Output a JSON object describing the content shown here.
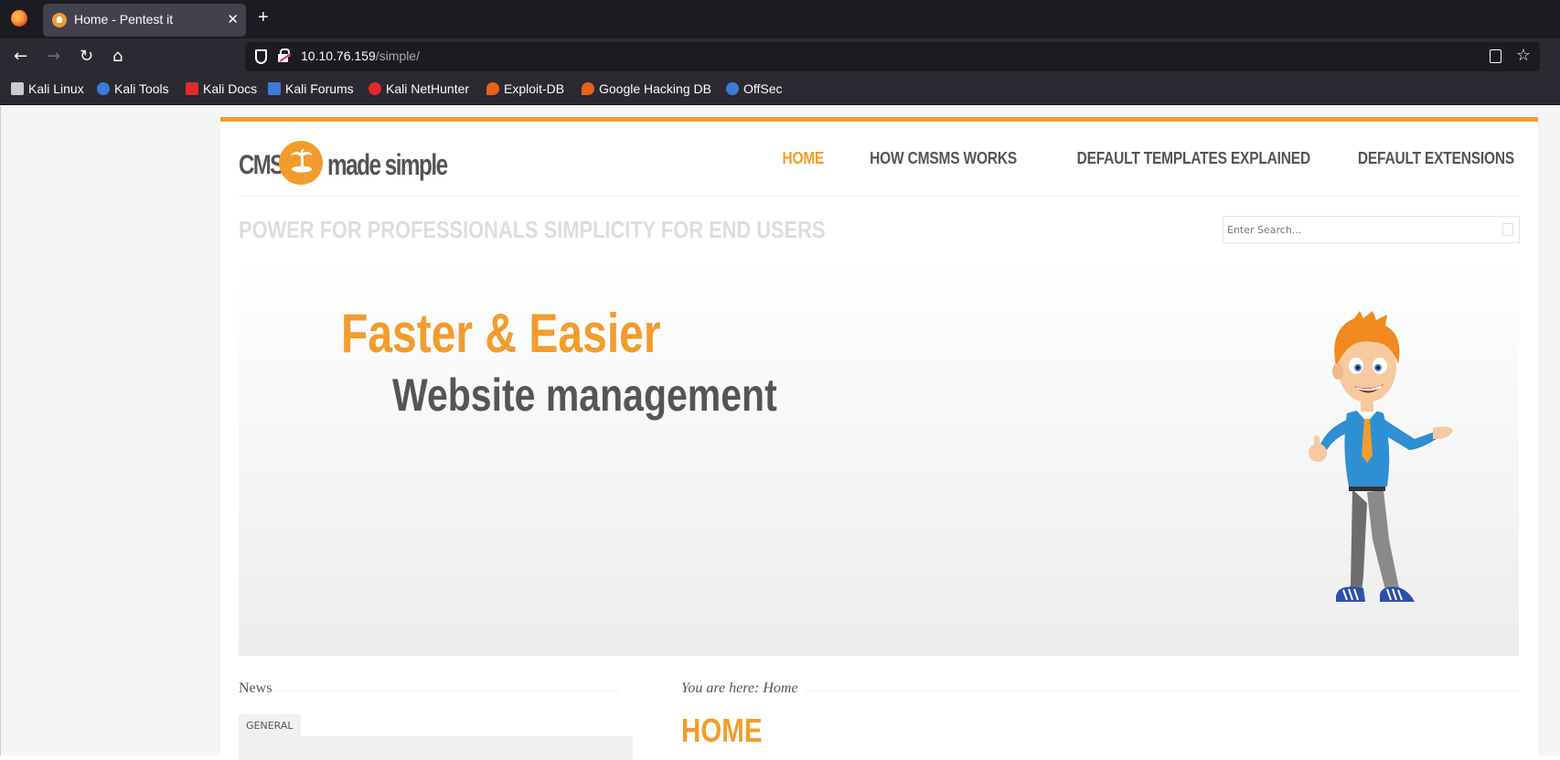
{
  "browser": {
    "tab_title": "Home - Pentest it",
    "tab_close": "✕",
    "new_tab": "+",
    "url_host": "10.10.76.159",
    "url_path": "/simple/",
    "bookmarks": [
      {
        "label": "Kali Linux",
        "icon": "kali-dragon-icon",
        "color": "#cccccc"
      },
      {
        "label": "Kali Tools",
        "icon": "kali-tools-icon",
        "color": "#3b7ad9"
      },
      {
        "label": "Kali Docs",
        "icon": "kali-docs-icon",
        "color": "#e22828"
      },
      {
        "label": "Kali Forums",
        "icon": "kali-forums-icon",
        "color": "#3b7ad9"
      },
      {
        "label": "Kali NetHunter",
        "icon": "nethunter-icon",
        "color": "#e22828"
      },
      {
        "label": "Exploit-DB",
        "icon": "exploit-db-icon",
        "color": "#e8621a"
      },
      {
        "label": "Google Hacking DB",
        "icon": "ghdb-icon",
        "color": "#e8621a"
      },
      {
        "label": "OffSec",
        "icon": "offsec-icon",
        "color": "#3b7ad9"
      }
    ]
  },
  "site": {
    "logo_left": "CMS",
    "logo_right": "made simple",
    "nav": [
      {
        "label": "HOME",
        "active": true
      },
      {
        "label": "HOW CMSMS WORKS",
        "active": false
      },
      {
        "label": "DEFAULT TEMPLATES EXPLAINED",
        "active": false
      },
      {
        "label": "DEFAULT EXTENSIONS",
        "active": false
      }
    ],
    "tagline": "POWER FOR PROFESSIONALS SIMPLICITY FOR END USERS",
    "search_placeholder": "Enter Search...",
    "hero_title": "Faster & Easier",
    "hero_subtitle": "Website management",
    "news_heading": "News",
    "news_tab": "GENERAL",
    "breadcrumb": "You are here: Home",
    "page_heading": "HOME"
  },
  "colors": {
    "accent": "#f39c2c",
    "text": "#555555"
  }
}
